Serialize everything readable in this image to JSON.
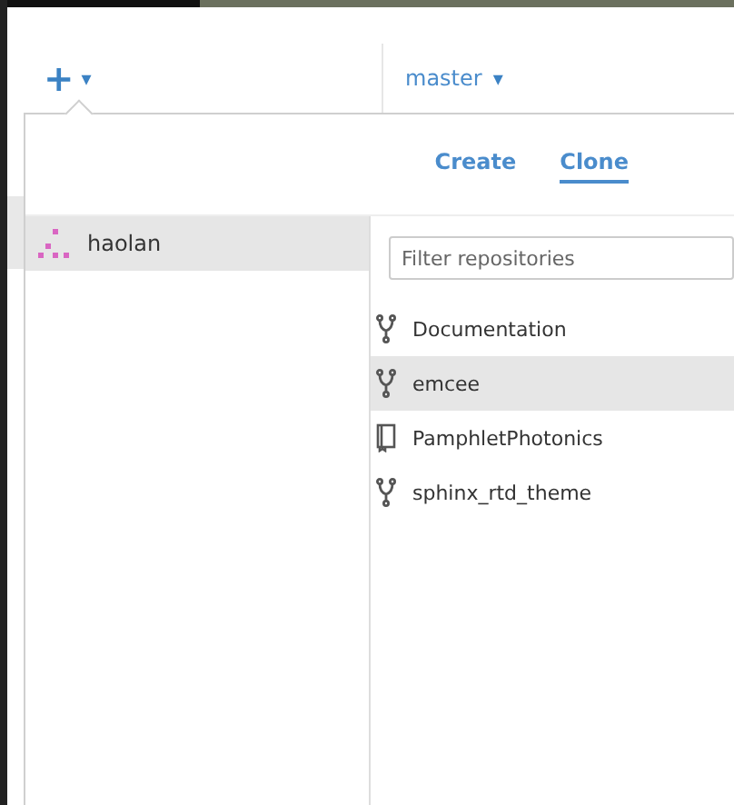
{
  "toolbar": {
    "add_glyph": "+",
    "add_caret": "▾",
    "branch": "master",
    "branch_caret": "▾"
  },
  "tabs": [
    {
      "label": "Create",
      "selected": false
    },
    {
      "label": "Clone",
      "selected": true
    }
  ],
  "accounts": [
    {
      "name": "haolan",
      "selected": true
    }
  ],
  "filter": {
    "placeholder": "Filter repositories"
  },
  "repositories": [
    {
      "name": "Documentation",
      "kind": "fork",
      "selected": false
    },
    {
      "name": "emcee",
      "kind": "fork",
      "selected": true
    },
    {
      "name": "PamphletPhotonics",
      "kind": "repo",
      "selected": false
    },
    {
      "name": "sphinx_rtd_theme",
      "kind": "fork",
      "selected": false
    }
  ]
}
